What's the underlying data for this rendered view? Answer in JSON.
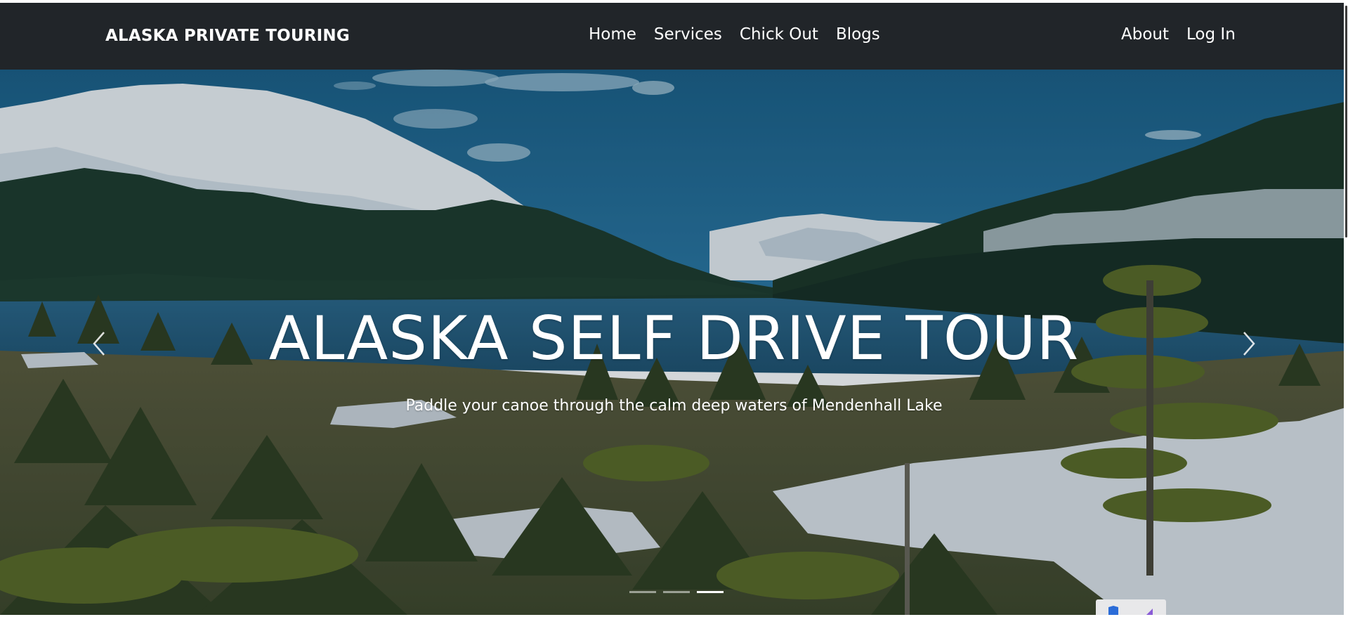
{
  "navbar": {
    "brand": "ALASKA PRIVATE TOURING",
    "center_links": [
      "Home",
      "Services",
      "Chick Out",
      "Blogs"
    ],
    "right_links": [
      "About",
      "Log In"
    ]
  },
  "hero": {
    "title": "ALASKA SELF DRIVE TOUR",
    "subtitle": "Paddle your canoe through the calm deep waters of Mendenhall Lake",
    "slide_count": 3,
    "active_slide": 3
  },
  "colors": {
    "navbar_bg": "#212529",
    "nav_text": "#ffffff"
  },
  "icons": {
    "prev": "chevron-left-icon",
    "next": "chevron-right-icon"
  }
}
